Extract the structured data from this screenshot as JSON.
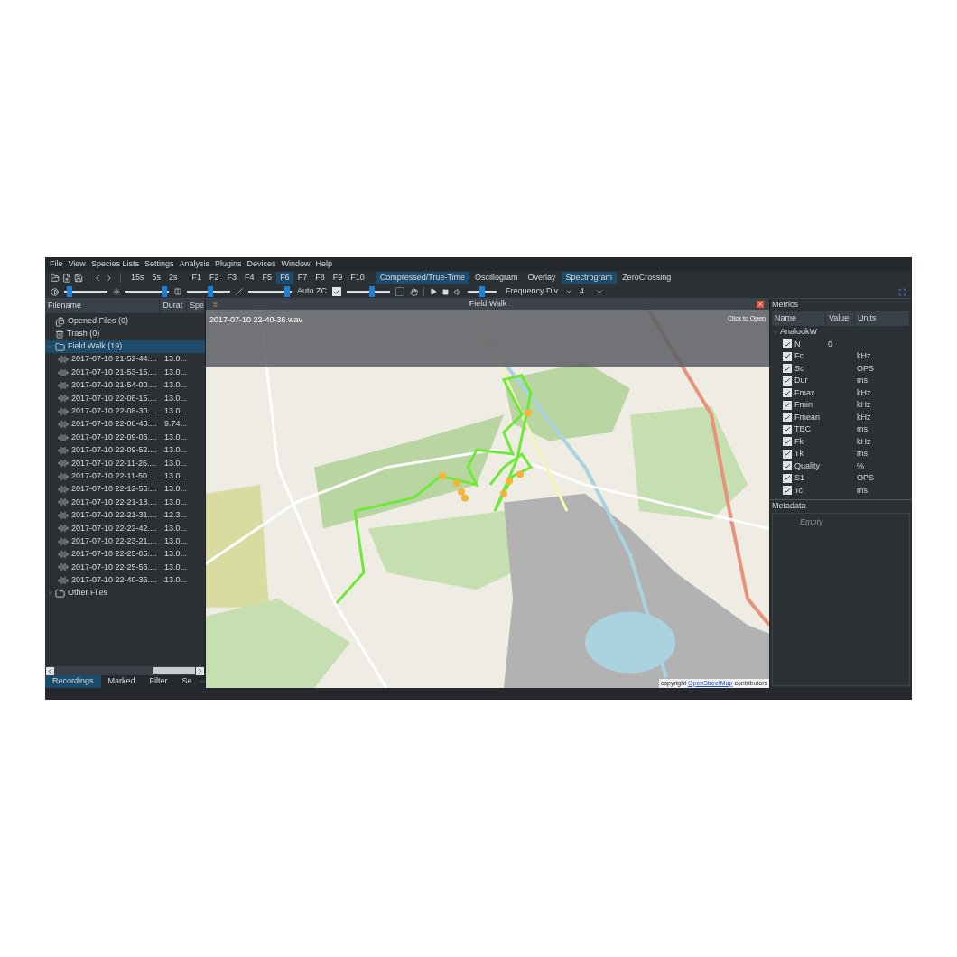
{
  "menu": [
    "File",
    "View",
    "Species Lists",
    "Settings",
    "Analysis",
    "Plugins",
    "Devices",
    "Window",
    "Help"
  ],
  "toolbar": {
    "presets": [
      "15s",
      "5s",
      "2s"
    ],
    "function_keys": [
      {
        "label": "F1",
        "selected": false
      },
      {
        "label": "F2",
        "selected": false
      },
      {
        "label": "F3",
        "selected": false
      },
      {
        "label": "F4",
        "selected": false
      },
      {
        "label": "F5",
        "selected": false
      },
      {
        "label": "F6",
        "selected": true
      },
      {
        "label": "F7",
        "selected": false
      },
      {
        "label": "F8",
        "selected": false
      },
      {
        "label": "F9",
        "selected": false
      },
      {
        "label": "F10",
        "selected": false
      }
    ],
    "view_modes": [
      {
        "label": "Compressed/True-Time",
        "selected": true
      },
      {
        "label": "Oscillogram",
        "selected": false
      },
      {
        "label": "Overlay",
        "selected": false
      },
      {
        "label": "Spectrogram",
        "selected": true
      },
      {
        "label": "ZeroCrossing",
        "selected": false
      }
    ],
    "sliders": [
      {
        "level": 0.08
      },
      {
        "level": 0.95
      },
      {
        "level": 0.55
      },
      {
        "level": 0.95
      }
    ],
    "auto_zc": {
      "label": "Auto ZC",
      "checked": true
    },
    "zc_slider": {
      "level": 0.6
    },
    "second_check": {
      "checked": false
    },
    "volume": {
      "level": 0.5
    },
    "division": {
      "value": "Frequency Div"
    },
    "divisor": {
      "value": "4"
    }
  },
  "files": {
    "columns": [
      "Filename",
      "Durat",
      "Spe"
    ],
    "tree": [
      {
        "kind": "files",
        "label": "Opened Files (0)",
        "selected": false
      },
      {
        "kind": "trash",
        "label": "Trash (0)",
        "selected": false
      },
      {
        "kind": "folder",
        "label": "Field Walk (19)",
        "expanded": true,
        "selected": true,
        "children": [
          {
            "label": "2017-07-10 21-52-44....",
            "duration": "13.0..."
          },
          {
            "label": "2017-07-10 21-53-15....",
            "duration": "13.0..."
          },
          {
            "label": "2017-07-10 21-54-00....",
            "duration": "13.0..."
          },
          {
            "label": "2017-07-10 22-06-15....",
            "duration": "13.0..."
          },
          {
            "label": "2017-07-10 22-08-30....",
            "duration": "13.0..."
          },
          {
            "label": "2017-07-10 22-08-43....",
            "duration": "9.74..."
          },
          {
            "label": "2017-07-10 22-09-06....",
            "duration": "13.0..."
          },
          {
            "label": "2017-07-10 22-09-52....",
            "duration": "13.0..."
          },
          {
            "label": "2017-07-10 22-11-26....",
            "duration": "13.0..."
          },
          {
            "label": "2017-07-10 22-11-50....",
            "duration": "13.0..."
          },
          {
            "label": "2017-07-10 22-12-56....",
            "duration": "13.0..."
          },
          {
            "label": "2017-07-10 22-21-18....",
            "duration": "13.0..."
          },
          {
            "label": "2017-07-10 22-21-31....",
            "duration": "12.3..."
          },
          {
            "label": "2017-07-10 22-22-42....",
            "duration": "13.0..."
          },
          {
            "label": "2017-07-10 22-23-21....",
            "duration": "13.0..."
          },
          {
            "label": "2017-07-10 22-25-05....",
            "duration": "13.0..."
          },
          {
            "label": "2017-07-10 22-25-56....",
            "duration": "13.0..."
          },
          {
            "label": "2017-07-10 22-40-36....",
            "duration": "13.0..."
          }
        ]
      },
      {
        "kind": "folder",
        "label": "Other Files",
        "expanded": false,
        "selected": false
      }
    ],
    "tabs": [
      {
        "label": "Recordings",
        "selected": true
      },
      {
        "label": "Marked",
        "selected": false
      },
      {
        "label": "Filter",
        "selected": false
      },
      {
        "label": "Se",
        "selected": false
      }
    ]
  },
  "map_panel": {
    "title": "Field Walk",
    "file": "2017-07-10 22-40-36.wav",
    "open_hint": "Click to Open",
    "attribution_prefix": "copyright",
    "attribution_link": "OpenStreetMap",
    "attribution_suffix": "contributors"
  },
  "metrics": {
    "title": "Metrics",
    "columns": [
      "Name",
      "Value",
      "Units"
    ],
    "group": {
      "label": "AnalookW",
      "expanded": true
    },
    "items": [
      {
        "name": "N",
        "value": "0",
        "checked": true
      },
      {
        "name": "Fc",
        "units": "kHz",
        "checked": true
      },
      {
        "name": "Sc",
        "units": "OPS",
        "checked": true
      },
      {
        "name": "Dur",
        "units": "ms",
        "checked": true
      },
      {
        "name": "Fmax",
        "units": "kHz",
        "checked": true
      },
      {
        "name": "Fmin",
        "units": "kHz",
        "checked": true
      },
      {
        "name": "Fmean",
        "units": "kHz",
        "checked": true
      },
      {
        "name": "TBC",
        "units": "ms",
        "checked": true
      },
      {
        "name": "Fk",
        "units": "kHz",
        "checked": true
      },
      {
        "name": "Tk",
        "units": "ms",
        "checked": true
      },
      {
        "name": "Quality",
        "units": "%",
        "checked": true
      },
      {
        "name": "S1",
        "units": "OPS",
        "checked": true
      },
      {
        "name": "Tc",
        "units": "ms",
        "checked": true
      }
    ]
  },
  "metadata": {
    "title": "Metadata",
    "empty": "Empty"
  }
}
